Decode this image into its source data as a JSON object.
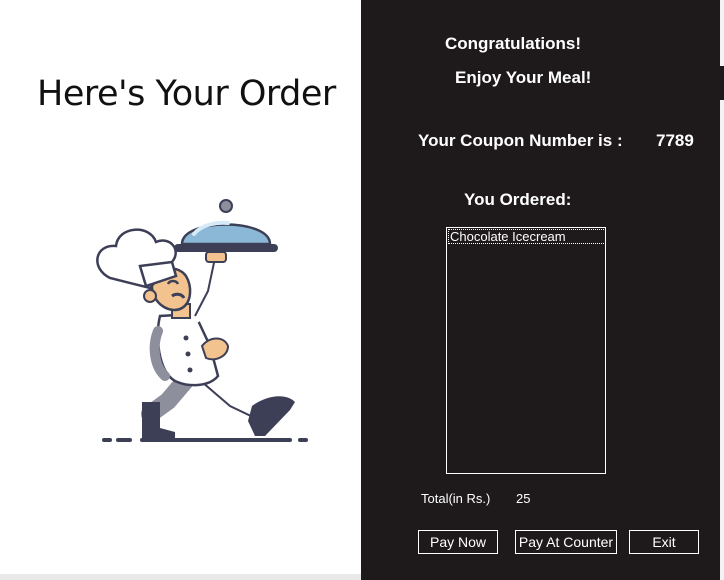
{
  "left": {
    "heading": "Here's Your Order",
    "illustration": "waiter-with-cloche"
  },
  "right": {
    "congrats": "Congratulations!",
    "enjoy": "Enjoy Your Meal!",
    "coupon_label": "Your Coupon Number is :",
    "coupon_number": "7789",
    "ordered_label": "You Ordered:",
    "ordered_items": [
      "Chocolate Icecream"
    ],
    "total_label": "Total(in Rs.)",
    "total_value": "25",
    "buttons": {
      "pay_now": "Pay Now",
      "pay_at_counter": "Pay At Counter",
      "exit": "Exit"
    }
  },
  "colors": {
    "panel_bg": "#1e1a1b",
    "left_bg": "#ffffff",
    "text": "#ffffff"
  }
}
